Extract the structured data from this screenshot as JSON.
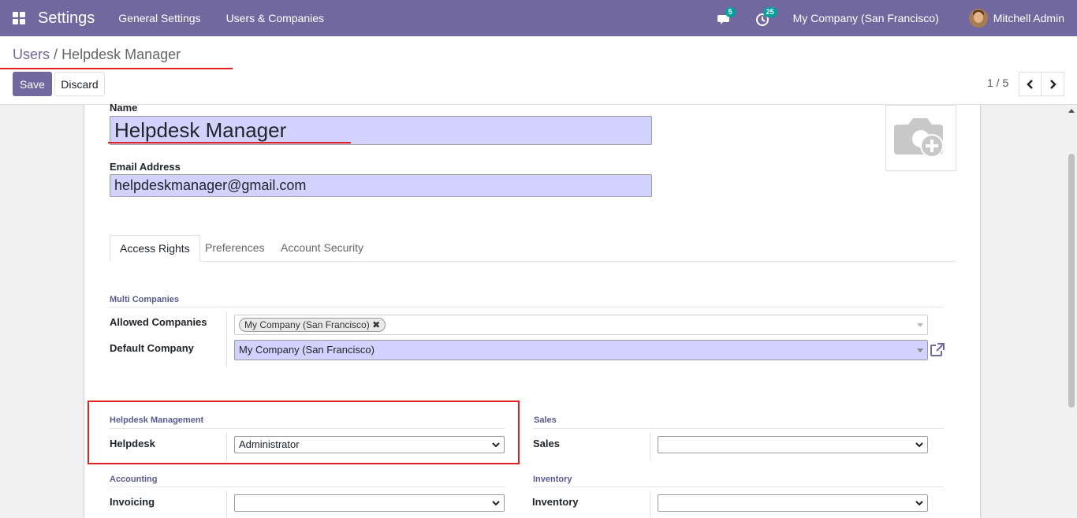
{
  "navbar": {
    "app_title": "Settings",
    "menu": [
      "General Settings",
      "Users & Companies"
    ],
    "messages_count": "5",
    "activities_count": "25",
    "company": "My Company (San Francisco)",
    "user": "Mitchell Admin",
    "bg_color": "#7268a0"
  },
  "control_panel": {
    "breadcrumb_parent": "Users",
    "breadcrumb_sep": "/",
    "breadcrumb_current": "Helpdesk Manager",
    "save_label": "Save",
    "discard_label": "Discard",
    "pager": "1 / 5"
  },
  "form": {
    "name_label": "Name",
    "name_value": "Helpdesk Manager",
    "email_label": "Email Address",
    "email_value": "helpdeskmanager@gmail.com",
    "tabs": [
      "Access Rights",
      "Preferences",
      "Account Security"
    ],
    "multi_companies_title": "Multi Companies",
    "allowed_companies_label": "Allowed Companies",
    "allowed_companies_tag": "My Company (San Francisco)",
    "default_company_label": "Default Company",
    "default_company_value": "My Company (San Francisco)",
    "helpdesk_section_title": "Helpdesk Management",
    "helpdesk_label": "Helpdesk",
    "helpdesk_value": "Administrator",
    "sales_section_title": "Sales",
    "sales_label": "Sales",
    "sales_value": "",
    "accounting_section_title": "Accounting",
    "invoicing_label": "Invoicing",
    "invoicing_value": "",
    "inventory_section_title": "Inventory",
    "inventory_label": "Inventory",
    "inventory_value": ""
  }
}
